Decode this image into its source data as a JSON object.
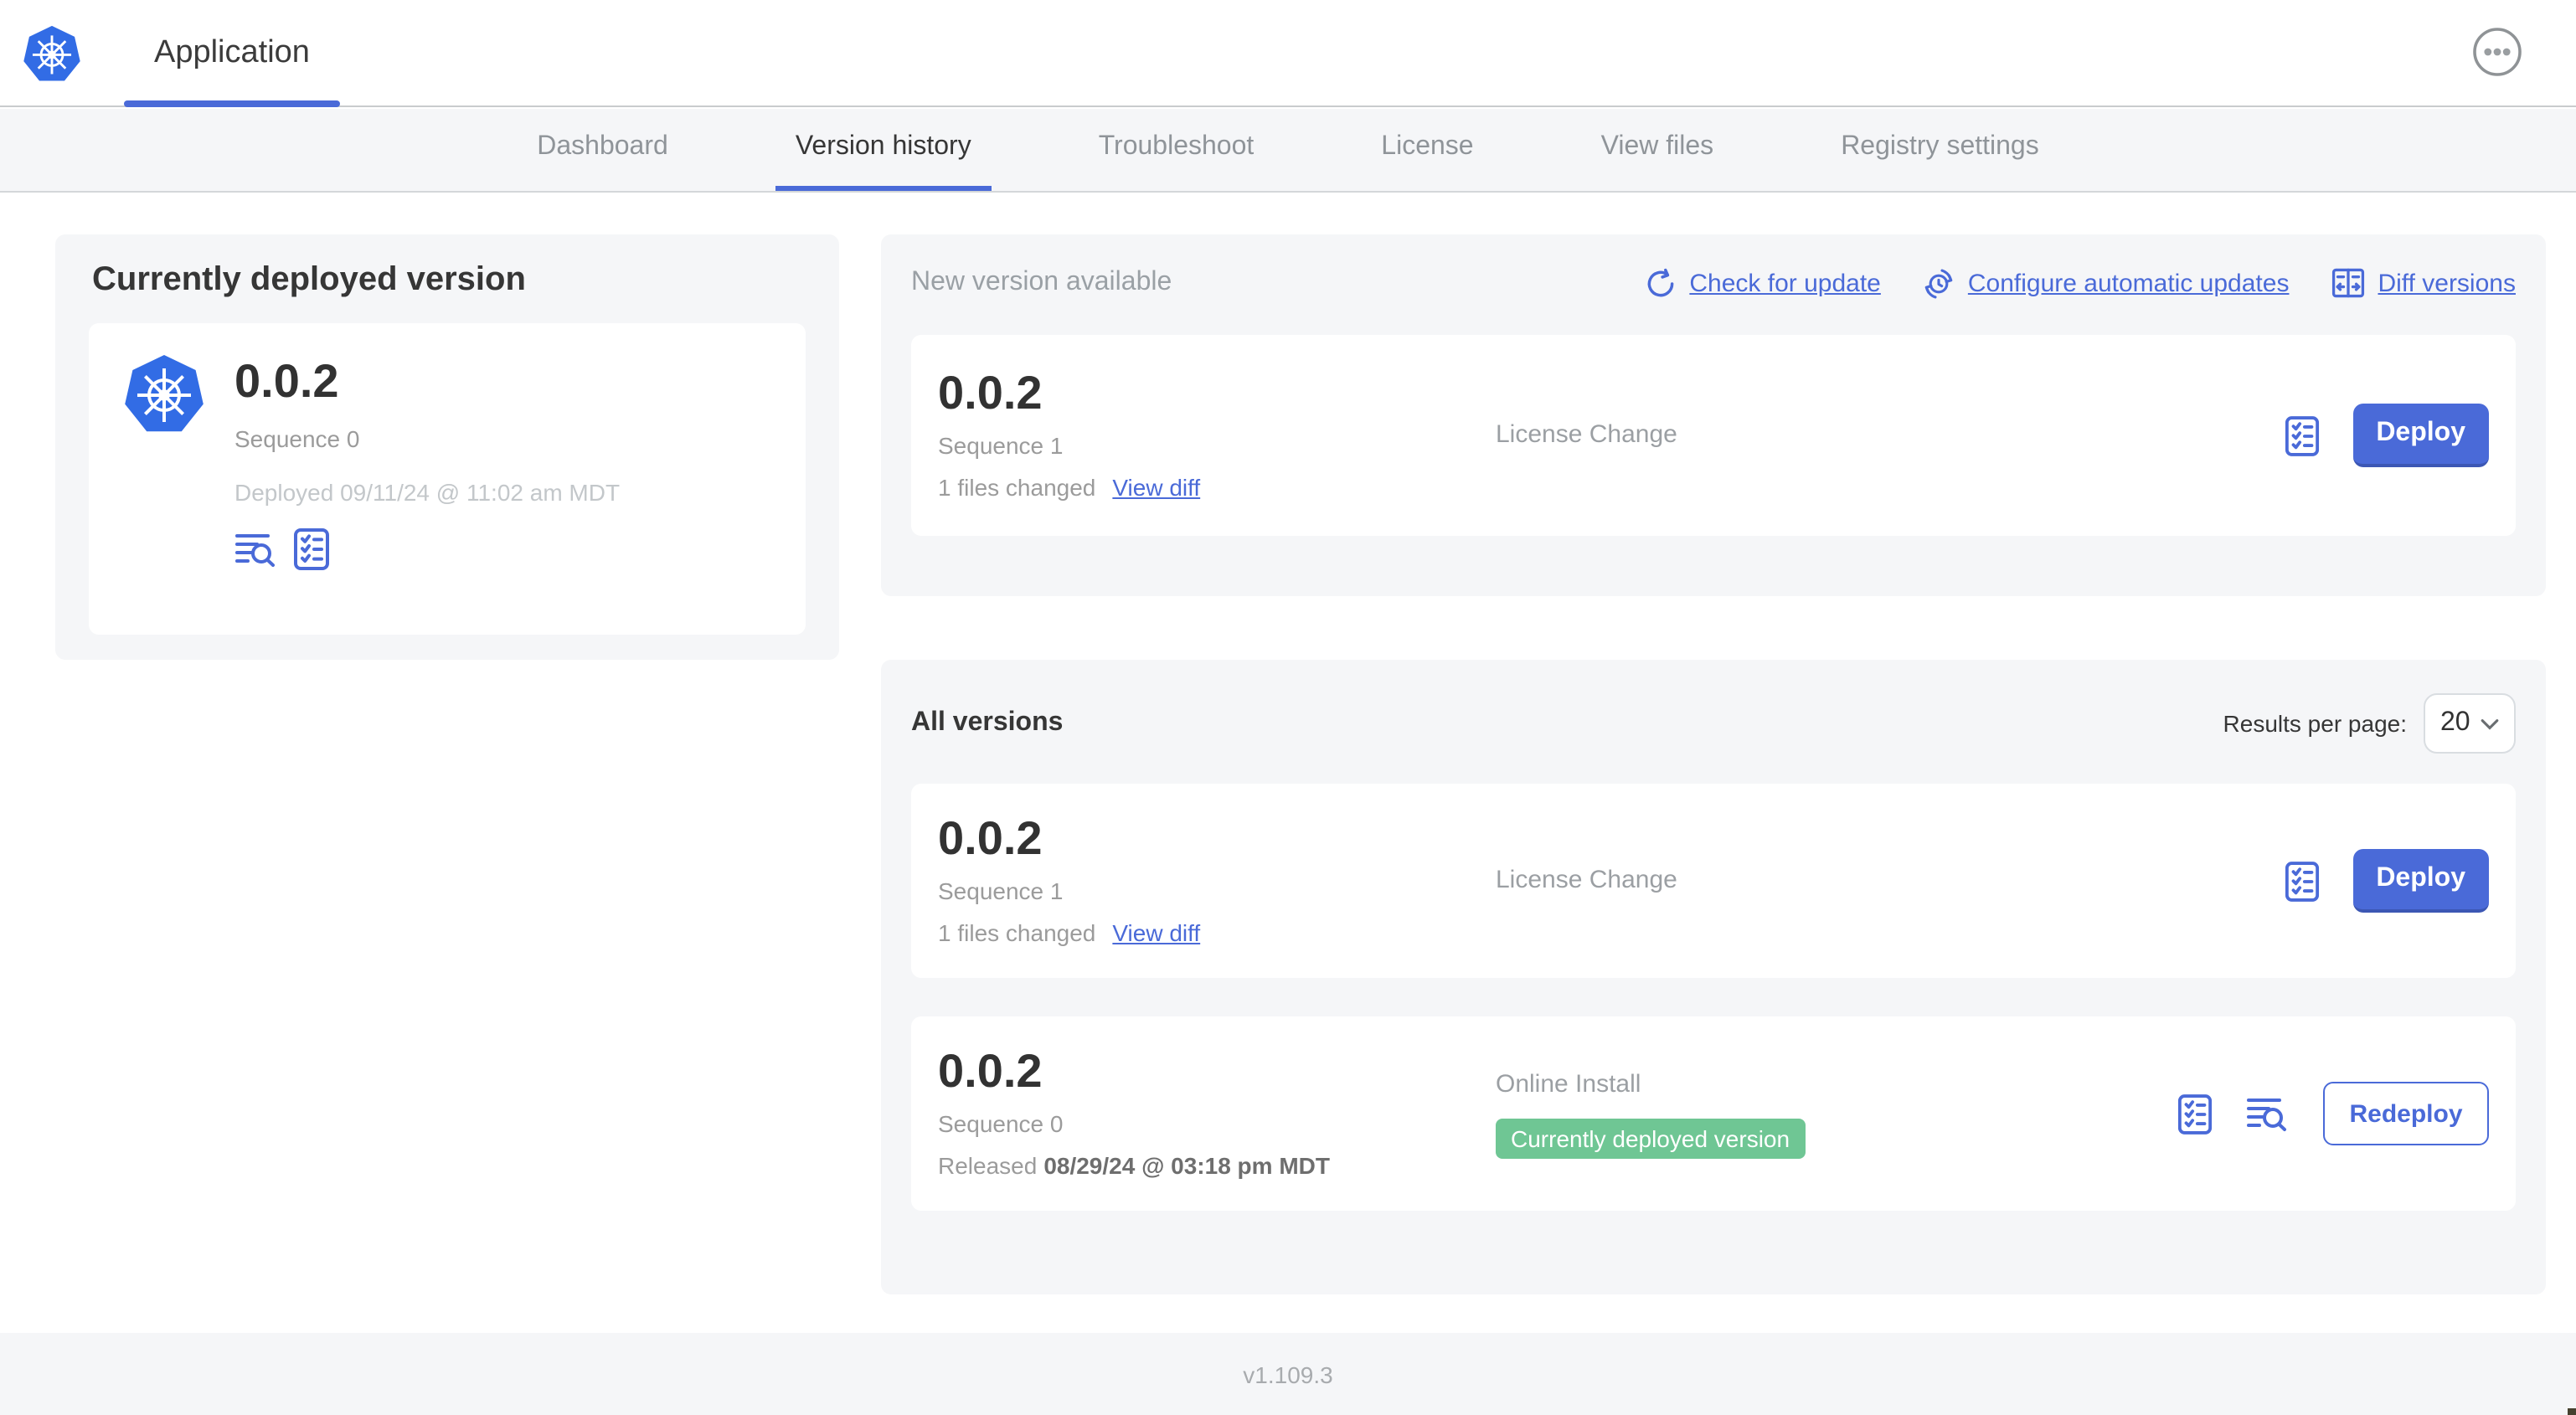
{
  "header": {
    "app_title": "Application"
  },
  "nav": {
    "active_tab": "Version history",
    "tabs": [
      {
        "label": "Dashboard"
      },
      {
        "label": "Version history"
      },
      {
        "label": "Troubleshoot"
      },
      {
        "label": "License"
      },
      {
        "label": "View files"
      },
      {
        "label": "Registry settings"
      }
    ]
  },
  "current_version": {
    "title": "Currently deployed version",
    "version": "0.0.2",
    "sequence": "Sequence 0",
    "deployed": "Deployed 09/11/24 @ 11:02 am MDT"
  },
  "new_version": {
    "title": "New version available",
    "actions": {
      "check": "Check for update",
      "configure": "Configure automatic updates",
      "diff": "Diff versions"
    },
    "card": {
      "version": "0.0.2",
      "sequence": "Sequence 1",
      "files_changed": "1 files changed",
      "view_diff": "View diff",
      "source": "License Change",
      "deploy": "Deploy"
    }
  },
  "all_versions": {
    "title": "All versions",
    "results_per_page_label": "Results per page:",
    "results_per_page_value": "20",
    "rows": [
      {
        "version": "0.0.2",
        "sequence": "Sequence 1",
        "files_changed": "1 files changed",
        "view_diff": "View diff",
        "source": "License Change",
        "action": "Deploy"
      },
      {
        "version": "0.0.2",
        "sequence": "Sequence 0",
        "released_prefix": "Released",
        "released_date": "08/29/24 @ 03:18 pm MDT",
        "source": "Online Install",
        "badge": "Currently deployed version",
        "action": "Redeploy"
      }
    ]
  },
  "footer": {
    "app_version": "v1.109.3"
  },
  "colors": {
    "accent_blue": "#4a6ad8",
    "logo_blue": "#326ce5",
    "badge_green": "#6fc694",
    "panel_bg": "#f5f6f8",
    "muted_text": "#9b9b9b",
    "faint_text": "#c3c7ca"
  }
}
